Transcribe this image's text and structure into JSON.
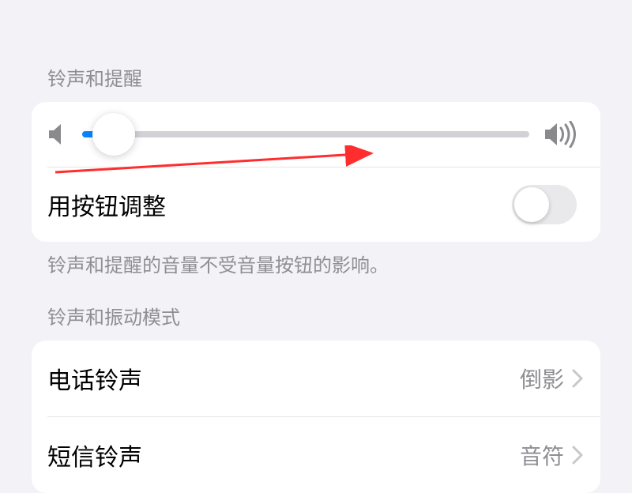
{
  "section1": {
    "header": "铃声和提醒",
    "toggle_label": "用按钮调整",
    "footer": "铃声和提醒的音量不受音量按钮的影响。",
    "slider_percent": 7,
    "toggle_on": false
  },
  "section2": {
    "header": "铃声和振动模式",
    "rows": [
      {
        "label": "电话铃声",
        "value": "倒影"
      },
      {
        "label": "短信铃声",
        "value": "音符"
      }
    ]
  }
}
